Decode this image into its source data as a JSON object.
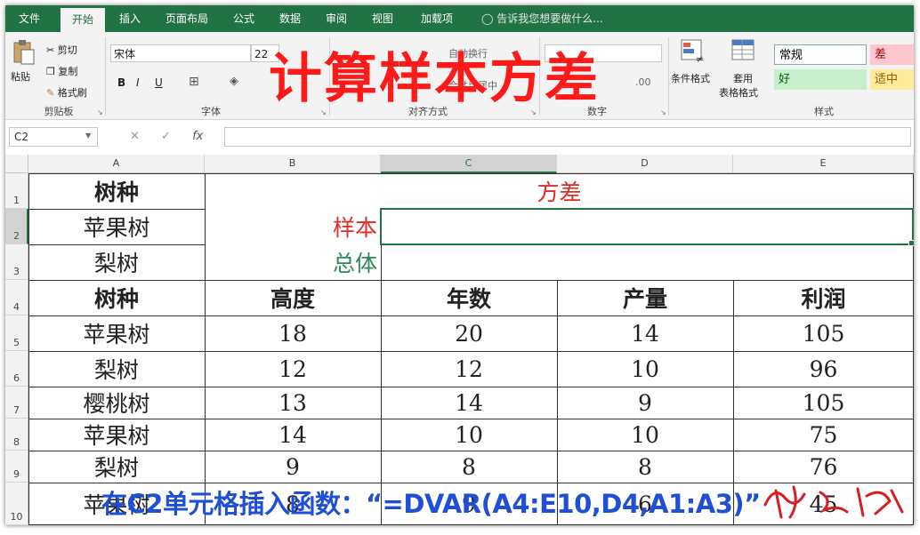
{
  "tabs": [
    "文件",
    "开始",
    "插入",
    "页面布局",
    "公式",
    "数据",
    "审阅",
    "视图",
    "加载项"
  ],
  "tell_me": "告诉我您想要做什么...",
  "ribbon": {
    "paste": "粘贴",
    "cut": "剪切",
    "copy": "复制",
    "format_painter": "格式刷",
    "clipboard_group": "剪贴板",
    "font_name": "宋体",
    "font_size": "22",
    "font_group": "字体",
    "bold": "B",
    "italic": "I",
    "underline": "U",
    "wrap_text": "自动换行",
    "merge_center": "合并后居中",
    "align_group": "对齐方式",
    "number_format": "常规",
    "number_group": "数字",
    "cond_format": "条件格式",
    "table_format_1": "套用",
    "table_format_2": "表格格式",
    "styles_group": "样式",
    "style_normal": "常规",
    "style_bad": "差",
    "style_good": "好",
    "style_neutral": "适中"
  },
  "formula_bar": {
    "name_box": "C2",
    "cancel": "✕",
    "enter": "✓",
    "fx": "fx",
    "value": ""
  },
  "columns": [
    "A",
    "B",
    "C",
    "D",
    "E"
  ],
  "rows": [
    "1",
    "2",
    "3",
    "4",
    "5",
    "6",
    "7",
    "8",
    "9",
    "10"
  ],
  "cells": {
    "A1": "树种",
    "B1": "方差",
    "A2": "苹果树",
    "B2": "样本",
    "A3": "梨树",
    "B3": "总体",
    "A4": "树种",
    "B4": "高度",
    "C4": "年数",
    "D4": "产量",
    "E4": "利润",
    "A5": "苹果树",
    "B5": "18",
    "C5": "20",
    "D5": "14",
    "E5": "105",
    "A6": "梨树",
    "B6": "12",
    "C6": "12",
    "D6": "10",
    "E6": "96",
    "A7": "樱桃树",
    "B7": "13",
    "C7": "14",
    "D7": "9",
    "E7": "105",
    "A8": "苹果树",
    "B8": "14",
    "C8": "10",
    "D8": "10",
    "E8": "75",
    "A9": "梨树",
    "B9": "9",
    "C9": "8",
    "D9": "8",
    "E9": "76",
    "A10": "苹果树",
    "B10": "8",
    "C10": "9",
    "D10": "6",
    "E10": "45"
  },
  "overlay_title": "计算样本方差",
  "overlay_caption": "在C2单元格插入函数：“=DVAR(A4:E10,D4,A1:A3)”",
  "colors": {
    "excel_green": "#217346",
    "title_red": "#ff1a1a",
    "caption_blue": "#1f4fd6",
    "label_red": "#e02a2a",
    "label_green": "#2e8b57"
  }
}
